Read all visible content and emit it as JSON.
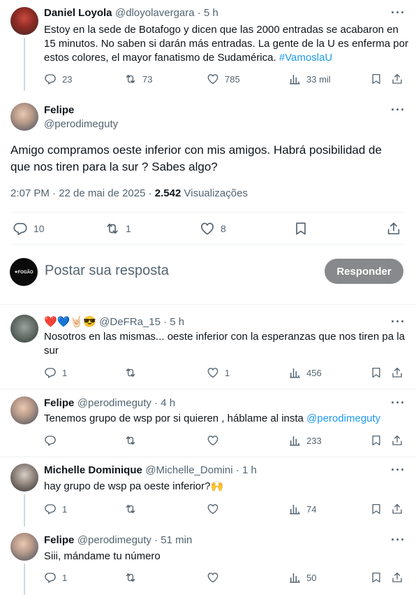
{
  "tweets": [
    {
      "name": "Daniel Loyola",
      "handle": "@dloyolavergara",
      "time": "5 h",
      "text": "Estoy en la sede de Botafogo y dicen que las 2000 entradas se acabaron en 15 minutos. No saben si darán más entradas. La gente de la U es enferma por estos colores,  el mayor fanatismo de Sudamérica. ",
      "hashtag": "#VamoslaU",
      "replies": "23",
      "reposts": "73",
      "likes": "785",
      "views": "33 mil"
    }
  ],
  "main": {
    "name": "Felipe",
    "handle": "@perodimeguty",
    "text": "Amigo compramos oeste inferior con mis amigos. Habrá posibilidad de que nos tiren para la sur ? Sabes algo?",
    "time": "2:07 PM · 22 de mai de 2025 · ",
    "views_count": "2.542",
    "views_label": " Visualizações",
    "replies": "10",
    "reposts": "1",
    "likes": "8"
  },
  "compose": {
    "avatar_text": "✦FOGÃO",
    "placeholder": "Postar sua resposta",
    "button": "Responder"
  },
  "replies": [
    {
      "name_emojis": "❤️💙🤘🏻😎",
      "handle": "@DeFRa_15",
      "time": "5 h",
      "text": "Nosotros en las mismas... oeste inferior con la esperanzas que nos tiren pa la sur",
      "replies": "1",
      "reposts": "",
      "likes": "1",
      "views": "456"
    },
    {
      "name": "Felipe",
      "handle": "@perodimeguty",
      "time": "4 h",
      "text": "Tenemos grupo de wsp por si quieren , háblame al insta ",
      "mention": "@perodimeguty",
      "replies": "",
      "reposts": "",
      "likes": "",
      "views": "233"
    },
    {
      "name": "Michelle Dominique",
      "handle": "@Michelle_Domini",
      "time": "1 h",
      "text": "hay grupo de wsp pa oeste inferior?🙌",
      "replies": "1",
      "reposts": "",
      "likes": "",
      "views": "74"
    },
    {
      "name": "Felipe",
      "handle": "@perodimeguty",
      "time": "51 min",
      "text": "Siii, mándame tu número",
      "replies": "1",
      "reposts": "",
      "likes": "",
      "views": "50"
    }
  ],
  "separator": " · ",
  "more": "···",
  "icons": [
    "reply-icon",
    "repost-icon",
    "like-icon",
    "views-icon",
    "bookmark-icon",
    "share-icon",
    "more-icon"
  ],
  "colors": {
    "link": "#1d9bf0",
    "secondary": "#536471",
    "button": "#87898c",
    "line": "#cfd9de"
  }
}
